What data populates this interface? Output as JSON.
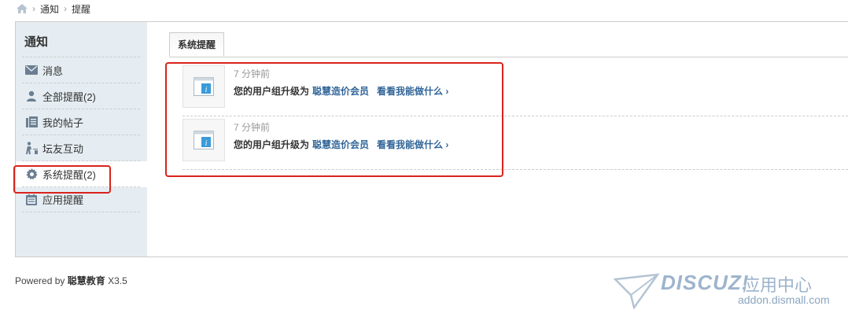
{
  "breadcrumb": {
    "items": [
      "通知",
      "提醒"
    ],
    "separator": "›"
  },
  "sidebar": {
    "title": "通知",
    "items": [
      {
        "label": "消息",
        "icon": "envelope-icon"
      },
      {
        "label": "全部提醒(2)",
        "icon": "user-icon"
      },
      {
        "label": "我的帖子",
        "icon": "posts-icon"
      },
      {
        "label": "坛友互动",
        "icon": "interaction-icon"
      },
      {
        "label": "系统提醒(2)",
        "icon": "gear-icon",
        "active": true
      },
      {
        "label": "应用提醒",
        "icon": "calendar-icon"
      }
    ]
  },
  "tabs": [
    {
      "label": "系统提醒",
      "active": true
    }
  ],
  "notices": [
    {
      "time": "7 分钟前",
      "text": "您的用户组升级为",
      "group": "聪慧造价会员",
      "link": "看看我能做什么 ›"
    },
    {
      "time": "7 分钟前",
      "text": "您的用户组升级为",
      "group": "聪慧造价会员",
      "link": "看看我能做什么 ›"
    }
  ],
  "footer": {
    "prefix": "Powered by",
    "brand": "聪慧教育",
    "version": "X3.5"
  },
  "watermark": {
    "logo": "DISCUZ!",
    "cn": "应用中心",
    "url": "addon.dismall.com"
  },
  "colors": {
    "sidebar_bg": "#e5edf2",
    "link": "#336699",
    "highlight": "#d9231b",
    "border": "#cdcdcd"
  }
}
